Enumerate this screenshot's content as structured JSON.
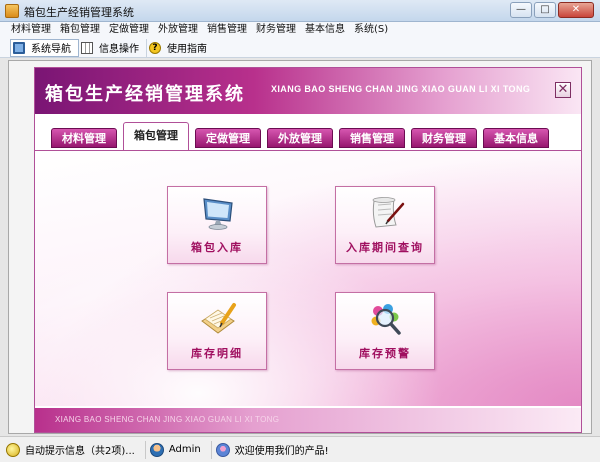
{
  "window": {
    "title": "箱包生产经销管理系统",
    "buttons": {
      "minimize": "—",
      "restore": "□",
      "close": "✕"
    }
  },
  "menubar": [
    "材料管理",
    "箱包管理",
    "定做管理",
    "外放管理",
    "销售管理",
    "财务管理",
    "基本信息",
    "系统(S)"
  ],
  "toolbar": [
    {
      "label": "系统导航",
      "icon": "monitor-icon",
      "active": true
    },
    {
      "label": "信息操作",
      "icon": "grid-icon",
      "active": false
    },
    {
      "label": "使用指南",
      "icon": "help-icon",
      "active": false
    }
  ],
  "panel": {
    "title": "箱包生产经销管理系统",
    "subtitle": "XIANG BAO SHENG CHAN JING XIAO GUAN LI XI TONG",
    "close": "✕",
    "footer": "XIANG BAO SHENG CHAN JING XIAO GUAN LI XI TONG"
  },
  "tabs": [
    "材料管理",
    "箱包管理",
    "定做管理",
    "外放管理",
    "销售管理",
    "财务管理",
    "基本信息"
  ],
  "active_tab": "箱包管理",
  "tiles": [
    {
      "label": "箱包入库",
      "icon": "monitor-icon"
    },
    {
      "label": "入库期间查询",
      "icon": "scroll-pen-icon"
    },
    {
      "label": "库存明细",
      "icon": "notebook-pencil-icon"
    },
    {
      "label": "库存预警",
      "icon": "magnifier-icon"
    }
  ],
  "statusbar": {
    "hint": "自动提示信息（共2项)...",
    "user": "Admin",
    "welcome": "欢迎使用我们的产品!"
  },
  "colors": {
    "accent": "#b8308c",
    "tile_text": "#a01060",
    "tab": "#c63aa0"
  }
}
